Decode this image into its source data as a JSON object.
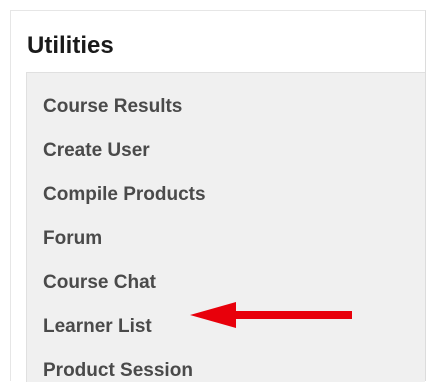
{
  "panel": {
    "title": "Utilities"
  },
  "menu": {
    "items": [
      {
        "label": "Course Results"
      },
      {
        "label": "Create User"
      },
      {
        "label": "Compile Products"
      },
      {
        "label": "Forum"
      },
      {
        "label": "Course Chat"
      },
      {
        "label": "Learner List"
      },
      {
        "label": "Product Session"
      }
    ]
  },
  "annotation": {
    "arrow_icon": "left-arrow-icon",
    "arrow_color": "#e8000b"
  }
}
